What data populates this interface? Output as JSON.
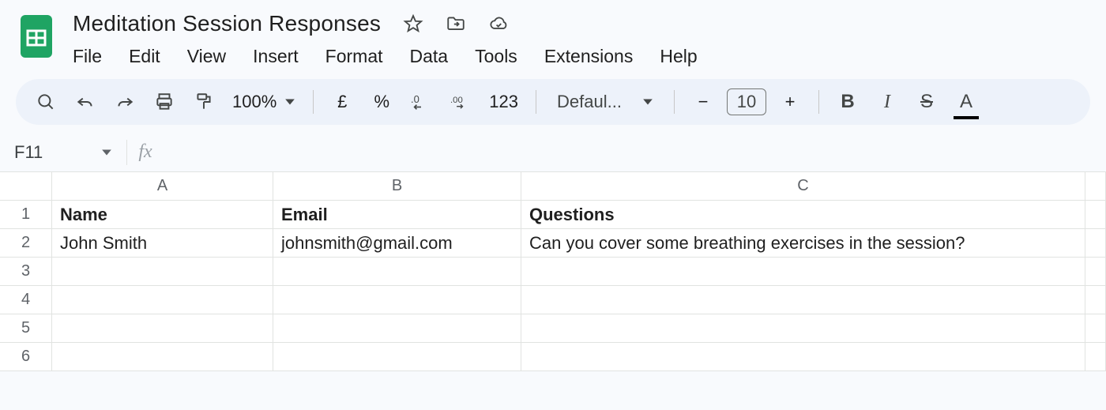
{
  "header": {
    "title": "Meditation Session Responses",
    "menu": [
      "File",
      "Edit",
      "View",
      "Insert",
      "Format",
      "Data",
      "Tools",
      "Extensions",
      "Help"
    ]
  },
  "toolbar": {
    "zoom": "100%",
    "currency_symbol": "£",
    "percent_symbol": "%",
    "dec_decrease": ".0",
    "dec_increase": ".00",
    "number_format": "123",
    "font_name": "Defaul...",
    "font_size": "10",
    "minus": "−",
    "plus": "+",
    "bold": "B",
    "italic": "I",
    "strike": "S",
    "text_color": "A"
  },
  "namebox": {
    "ref": "F11",
    "fx_label": "fx",
    "formula": ""
  },
  "grid": {
    "columns": [
      "A",
      "B",
      "C"
    ],
    "row_numbers": [
      "1",
      "2",
      "3",
      "4",
      "5",
      "6"
    ],
    "header_row": {
      "A": "Name",
      "B": "Email",
      "C": "Questions"
    },
    "rows": [
      {
        "A": "John Smith",
        "B": "johnsmith@gmail.com",
        "C": "Can you cover some breathing exercises in the session?"
      },
      {
        "A": "",
        "B": "",
        "C": ""
      },
      {
        "A": "",
        "B": "",
        "C": ""
      },
      {
        "A": "",
        "B": "",
        "C": ""
      },
      {
        "A": "",
        "B": "",
        "C": ""
      }
    ]
  }
}
